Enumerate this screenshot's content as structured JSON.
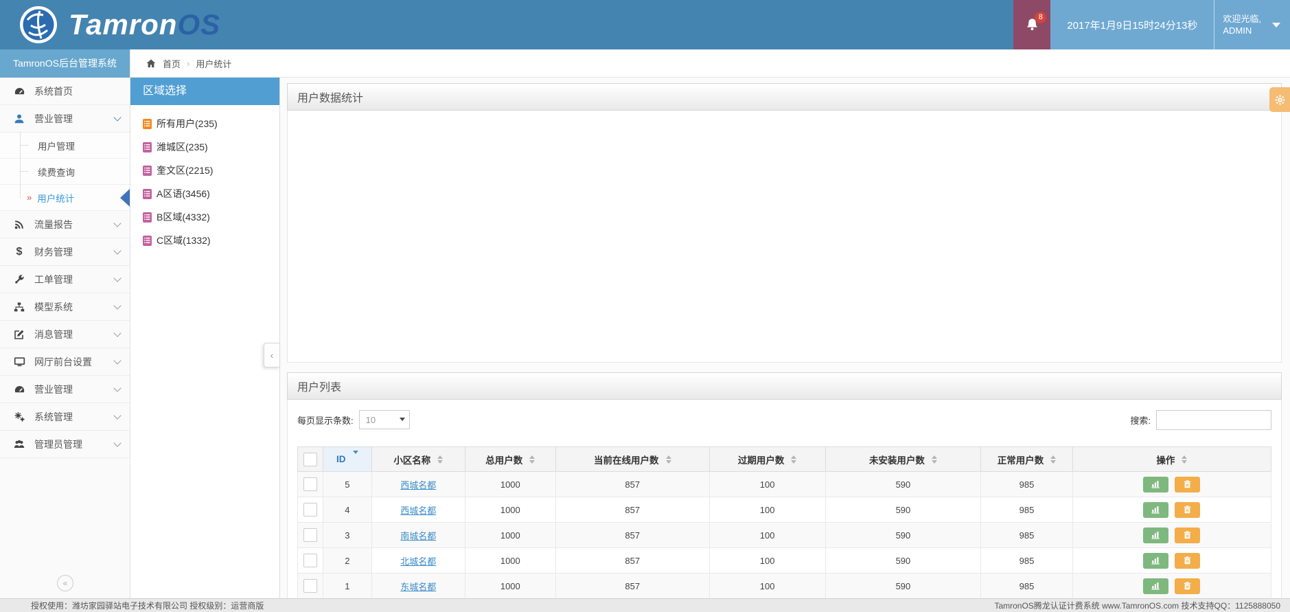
{
  "header": {
    "logo_primary": "Tamron",
    "logo_secondary": "OS",
    "notification_count": "8",
    "datetime": "2017年1月9日15时24分13秒",
    "welcome_line1": "欢迎光临,",
    "welcome_line2": "ADMIN"
  },
  "sidebar": {
    "title": "TamronOS后台管理系统",
    "items": [
      {
        "label": "系统首页",
        "icon": "dashboard-icon"
      },
      {
        "label": "营业管理",
        "icon": "user-icon",
        "expanded": true
      },
      {
        "label": "流量报告",
        "icon": "rss-icon"
      },
      {
        "label": "财务管理",
        "icon": "dollar-icon"
      },
      {
        "label": "工单管理",
        "icon": "wrench-icon"
      },
      {
        "label": "模型系统",
        "icon": "sitemap-icon"
      },
      {
        "label": "消息管理",
        "icon": "edit-icon"
      },
      {
        "label": "网厅前台设置",
        "icon": "desktop-icon"
      },
      {
        "label": "营业管理",
        "icon": "tachometer-icon"
      },
      {
        "label": "系统管理",
        "icon": "gears-icon"
      },
      {
        "label": "管理员管理",
        "icon": "users-icon"
      }
    ],
    "submenu": [
      {
        "label": "用户管理",
        "active": false
      },
      {
        "label": "续费查询",
        "active": false
      },
      {
        "label": "用户统计",
        "active": true
      }
    ]
  },
  "breadcrumb": {
    "home": "首页",
    "current": "用户统计"
  },
  "region_panel": {
    "title": "区域选择",
    "items": [
      {
        "label": "所有用户(235)",
        "icon_color": "#ef8b1f"
      },
      {
        "label": "潍城区(235)",
        "icon_color": "#c4619d"
      },
      {
        "label": "奎文区(2215)",
        "icon_color": "#c4619d"
      },
      {
        "label": "A区语(3456)",
        "icon_color": "#c4619d"
      },
      {
        "label": "B区域(4332)",
        "icon_color": "#c4619d"
      },
      {
        "label": "C区域(1332)",
        "icon_color": "#c4619d"
      }
    ]
  },
  "stats_panel": {
    "title": "用户数据统计"
  },
  "list_panel": {
    "title": "用户列表",
    "page_size_label": "每页显示条数:",
    "page_size_value": "10",
    "search_label": "搜索:",
    "table": {
      "columns": [
        "ID",
        "小区名称",
        "总用户数",
        "当前在线用户数",
        "过期用户数",
        "未安装用户数",
        "正常用户数",
        "操作"
      ],
      "sort_column": "ID",
      "sort_direction": "desc",
      "rows": [
        {
          "id": "5",
          "name": "西城名都",
          "total": "1000",
          "online": "857",
          "expired": "100",
          "uninstalled": "590",
          "normal": "985"
        },
        {
          "id": "4",
          "name": "西城名都",
          "total": "1000",
          "online": "857",
          "expired": "100",
          "uninstalled": "590",
          "normal": "985"
        },
        {
          "id": "3",
          "name": "南城名都",
          "total": "1000",
          "online": "857",
          "expired": "100",
          "uninstalled": "590",
          "normal": "985"
        },
        {
          "id": "2",
          "name": "北城名都",
          "total": "1000",
          "online": "857",
          "expired": "100",
          "uninstalled": "590",
          "normal": "985"
        },
        {
          "id": "1",
          "name": "东城名都",
          "total": "1000",
          "online": "857",
          "expired": "100",
          "uninstalled": "590",
          "normal": "985"
        }
      ]
    }
  },
  "footer": {
    "left": "授权使用：潍坊家园驿站电子技术有限公司  授权级别：运营商版",
    "right": "TamronOS腾龙认证计费系统 www.TamronOS.com 技术支持QQ：1125888050"
  },
  "colors": {
    "header_blue": "#4484b0",
    "light_blue_block": "#6fa9d2",
    "bell_maroon": "#8e4966",
    "badge_red": "#d0453c",
    "sidebar_title_blue": "#68a7ce",
    "region_header_blue": "#519ed3",
    "active_link_blue": "#3c9ade",
    "table_link_blue": "#3a8bc8",
    "success_green": "#7eb87e",
    "warning_orange": "#f3ad49",
    "gear_tab_orange": "#f5bc74"
  }
}
